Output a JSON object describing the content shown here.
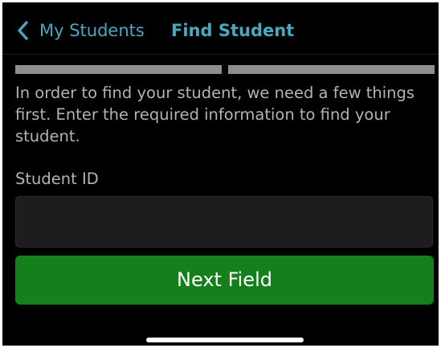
{
  "nav": {
    "back_label": "My Students",
    "back_icon": "chevron-left-icon",
    "title": "Find Student"
  },
  "progress": {
    "total_steps": 2
  },
  "form": {
    "instructions": "In order to find your student, we need a few things first. Enter the required information to find your student.",
    "field_label": "Student ID",
    "field_value": "",
    "next_label": "Next Field"
  },
  "colors": {
    "accent": "#4aa7c0",
    "button": "#147f1b",
    "background": "#000000",
    "progress": "#8e8e8e"
  }
}
